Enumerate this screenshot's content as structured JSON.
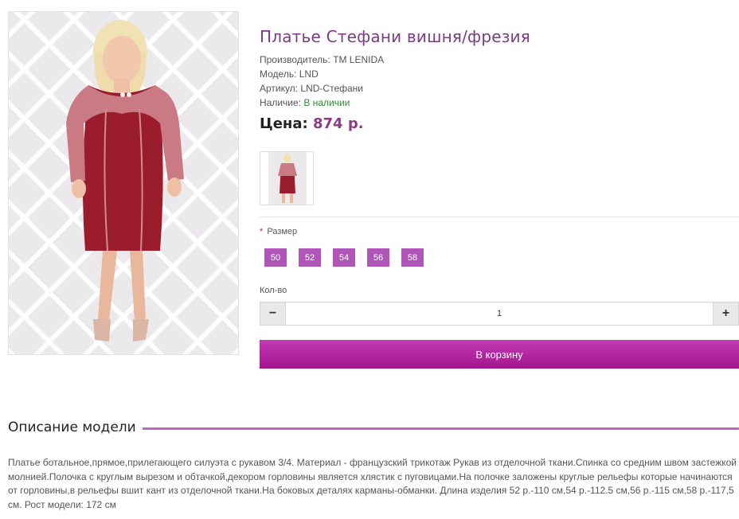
{
  "product": {
    "title": "Платье Стефани вишня/фрезия",
    "manufacturer_label": "Производитель:",
    "manufacturer": "TM LENIDA",
    "model_label": "Модель:",
    "model": "LND",
    "sku_label": "Артикул:",
    "sku": "LND-Стефани",
    "availability_label": "Наличие:",
    "availability": "В наличии",
    "price_label": "Цена:",
    "price": "874 р."
  },
  "options": {
    "size_required_mark": "*",
    "size_label": "Размер",
    "sizes": [
      "50",
      "52",
      "54",
      "56",
      "58"
    ],
    "qty_label": "Кол-во",
    "qty_value": "1",
    "minus": "−",
    "plus": "+"
  },
  "cart_button": "В корзину",
  "description": {
    "heading": "Описание модели",
    "text": "Платье ботальное,прямое,прилегающего силуэта с рукавом 3/4. Материал - французский трикотаж Рукав из отделочной ткани.Спинка со средним швом застежкой молнией.Полочка с круглым вырезом и обтачкой,декором горловины является хлястик с пуговицами.На полочке заложены круглые рельефы которые начинаются от горловины,в рельефы вшит кант из отделочной ткани.На боковых деталях карманы-обманки. Длина изделия 52 р.-110 см,54 р.-112.5 см,56 р.-115 см,58 р.-117,5 см. Рост модели: 172 см"
  },
  "colors": {
    "title": "#7a3a84",
    "accent": "#b056b8",
    "cart": "#b0209f",
    "available": "#2f8a2f",
    "dress": "#9b1c2c",
    "sleeve": "#c97a82"
  },
  "icons": {
    "main_photo": "model-photo",
    "thumb": "thumbnail-photo"
  }
}
